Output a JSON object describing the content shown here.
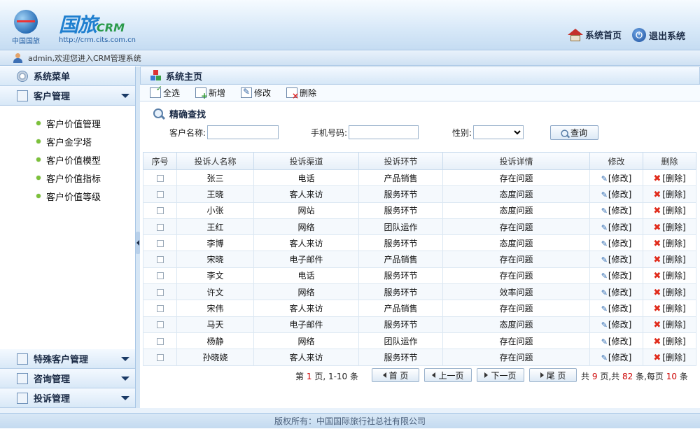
{
  "header": {
    "logo_caption": "中国国旅",
    "brand_main": "国旅",
    "brand_sub": "CRM",
    "brand_url": "http://crm.cits.com.cn",
    "home_label": "系统首页",
    "logout_label": "退出系统"
  },
  "welcome": {
    "text": "admin,欢迎您进入CRM管理系统"
  },
  "sidebar": {
    "title": "系统菜单",
    "group_open": "客户管理",
    "items": [
      {
        "label": "客户价值管理"
      },
      {
        "label": "客户金字塔"
      },
      {
        "label": "客户价值模型"
      },
      {
        "label": "客户价值指标"
      },
      {
        "label": "客户价值等级"
      }
    ],
    "bottom_groups": [
      {
        "label": "特殊客户管理"
      },
      {
        "label": "咨询管理"
      },
      {
        "label": "投诉管理"
      }
    ]
  },
  "main": {
    "title": "系统主页",
    "toolbar": {
      "select_all": "全选",
      "add": "新增",
      "edit": "修改",
      "delete": "删除"
    },
    "search": {
      "title": "精确查找",
      "name_label": "客户名称:",
      "name_value": "",
      "phone_label": "手机号码:",
      "phone_value": "",
      "gender_label": "性别:",
      "gender_value": "",
      "query_label": "查询"
    },
    "table": {
      "headers": [
        "序号",
        "投诉人名称",
        "投诉渠道",
        "投诉环节",
        "投诉详情",
        "修改",
        "删除"
      ],
      "edit_text": "[修改]",
      "delete_text": "[删除]",
      "rows": [
        {
          "name": "张三",
          "channel": "电话",
          "stage": "产品销售",
          "detail": "存在问题"
        },
        {
          "name": "王晓",
          "channel": "客人来访",
          "stage": "服务环节",
          "detail": "态度问题"
        },
        {
          "name": "小张",
          "channel": "网站",
          "stage": "服务环节",
          "detail": "态度问题"
        },
        {
          "name": "王红",
          "channel": "网络",
          "stage": "团队运作",
          "detail": "存在问题"
        },
        {
          "name": "李博",
          "channel": "客人来访",
          "stage": "服务环节",
          "detail": "态度问题"
        },
        {
          "name": "宋晓",
          "channel": "电子邮件",
          "stage": "产品销售",
          "detail": "存在问题"
        },
        {
          "name": "李文",
          "channel": "电话",
          "stage": "服务环节",
          "detail": "存在问题"
        },
        {
          "name": "许文",
          "channel": "网络",
          "stage": "服务环节",
          "detail": "效率问题"
        },
        {
          "name": "宋伟",
          "channel": "客人来访",
          "stage": "产品销售",
          "detail": "存在问题"
        },
        {
          "name": "马天",
          "channel": "电子邮件",
          "stage": "服务环节",
          "detail": "态度问题"
        },
        {
          "name": "杨静",
          "channel": "网络",
          "stage": "团队运作",
          "detail": "存在问题"
        },
        {
          "name": "孙晓娆",
          "channel": "客人来访",
          "stage": "服务环节",
          "detail": "存在问题"
        }
      ]
    },
    "pager": {
      "page_prefix": "第",
      "current_page": "1",
      "page_suffix": "页, 1-10 条",
      "first": "首 页",
      "prev": "上一页",
      "next": "下一页",
      "last": "尾 页",
      "total_prefix": "共",
      "total_pages": "9",
      "total_mid": "页,共",
      "total_records": "82",
      "total_mid2": "条,每页",
      "per_page": "10",
      "total_suffix": "条"
    }
  },
  "footer": {
    "text": "版权所有：中国国际旅行社总社有限公司"
  }
}
